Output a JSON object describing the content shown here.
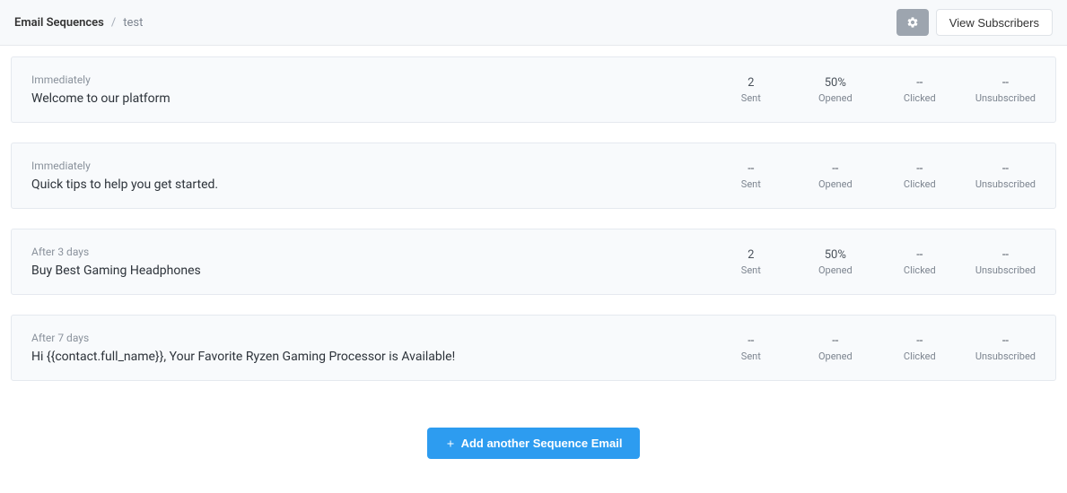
{
  "header": {
    "breadcrumb_root": "Email Sequences",
    "breadcrumb_sep": "/",
    "breadcrumb_current": "test",
    "view_subscribers_label": "View Subscribers"
  },
  "emails": [
    {
      "timing": "Immediately",
      "subject": "Welcome to our platform",
      "sent": "2",
      "opened": "50%",
      "clicked": "--",
      "unsubscribed": "--"
    },
    {
      "timing": "Immediately",
      "subject": "Quick tips to help you get started.",
      "sent": "--",
      "opened": "--",
      "clicked": "--",
      "unsubscribed": "--"
    },
    {
      "timing": "After 3 days",
      "subject": "Buy Best Gaming Headphones",
      "sent": "2",
      "opened": "50%",
      "clicked": "--",
      "unsubscribed": "--"
    },
    {
      "timing": "After 7 days",
      "subject": "Hi {{contact.full_name}}, Your Favorite Ryzen Gaming Processor is Available!",
      "sent": "--",
      "opened": "--",
      "clicked": "--",
      "unsubscribed": "--"
    }
  ],
  "stat_labels": {
    "sent": "Sent",
    "opened": "Opened",
    "clicked": "Clicked",
    "unsubscribed": "Unsubscribed"
  },
  "footer": {
    "add_label": "Add another Sequence Email"
  }
}
